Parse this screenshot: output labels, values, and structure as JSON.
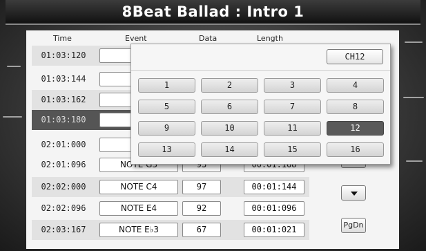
{
  "title": "8Beat Ballad : Intro 1",
  "columns": [
    "Time",
    "Event",
    "Data",
    "Length"
  ],
  "rows": [
    {
      "time": "01:03:120",
      "event": "NO",
      "data": "",
      "length": ""
    },
    {
      "time": "01:03:144",
      "event": "NO",
      "data": "",
      "length": ""
    },
    {
      "time": "01:03:162",
      "event": "NO",
      "data": "",
      "length": ""
    },
    {
      "time": "01:03:180",
      "event": "NO",
      "data": "",
      "length": ""
    },
    {
      "time": "02:01:000",
      "event": "NO",
      "data": "",
      "length": ""
    },
    {
      "time": "02:01:096",
      "event": "NOTE G3",
      "data": "93",
      "length": "00:01:168"
    },
    {
      "time": "02:02:000",
      "event": "NOTE C4",
      "data": "97",
      "length": "00:01:144"
    },
    {
      "time": "02:02:096",
      "event": "NOTE E4",
      "data": "92",
      "length": "00:01:096"
    },
    {
      "time": "02:03:167",
      "event": "NOTE E♭3",
      "data": "67",
      "length": "00:01:021"
    }
  ],
  "selected_row_index": 3,
  "popup": {
    "channel_label": "CH12",
    "channels": [
      "1",
      "2",
      "3",
      "4",
      "5",
      "6",
      "7",
      "8",
      "9",
      "10",
      "11",
      "12",
      "13",
      "14",
      "15",
      "16"
    ],
    "selected_channel": "12"
  },
  "side_buttons": {
    "down_icon": "triangle-down-icon",
    "pgdn_label": "PgDn"
  }
}
